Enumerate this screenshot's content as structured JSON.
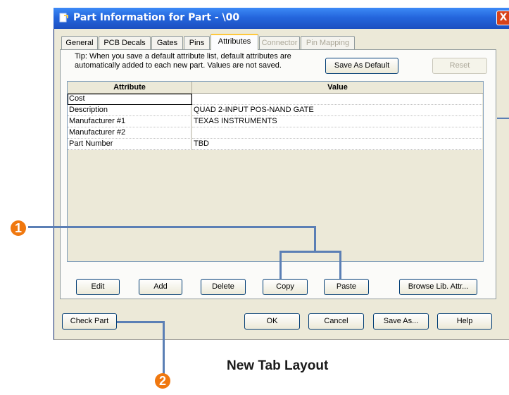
{
  "window": {
    "title": "Part Information for Part - \\00",
    "close_label": "X"
  },
  "tabs": [
    {
      "label": "General",
      "state": "normal"
    },
    {
      "label": "PCB Decals",
      "state": "normal"
    },
    {
      "label": "Gates",
      "state": "normal"
    },
    {
      "label": "Pins",
      "state": "normal"
    },
    {
      "label": "Attributes",
      "state": "active"
    },
    {
      "label": "Connector",
      "state": "disabled"
    },
    {
      "label": "Pin Mapping",
      "state": "disabled"
    }
  ],
  "tip": {
    "line1": "Tip: When you save a default attribute list, default attributes are",
    "line2": "automatically added to each new part. Values are not saved."
  },
  "top_buttons": {
    "save_default": "Save As Default",
    "reset": "Reset"
  },
  "grid": {
    "headers": {
      "attribute": "Attribute",
      "value": "Value"
    },
    "rows": [
      {
        "attribute": "Cost",
        "value": ""
      },
      {
        "attribute": "Description",
        "value": "QUAD 2-INPUT POS-NAND GATE"
      },
      {
        "attribute": "Manufacturer #1",
        "value": "TEXAS INSTRUMENTS"
      },
      {
        "attribute": "Manufacturer #2",
        "value": ""
      },
      {
        "attribute": "Part Number",
        "value": "TBD"
      }
    ]
  },
  "grid_buttons": {
    "edit": "Edit",
    "add": "Add",
    "delete": "Delete",
    "copy": "Copy",
    "paste": "Paste",
    "browse": "Browse Lib. Attr..."
  },
  "bottom_buttons": {
    "check_part": "Check Part",
    "ok": "OK",
    "cancel": "Cancel",
    "save_as": "Save As...",
    "help": "Help"
  },
  "callouts": {
    "one": "1",
    "two": "2"
  },
  "caption": "New Tab Layout",
  "colors": {
    "titlebar": "#2466dd",
    "callout_line": "#5b7fb5",
    "badge": "#f0780f",
    "tab_highlight": "#ffc83c"
  }
}
